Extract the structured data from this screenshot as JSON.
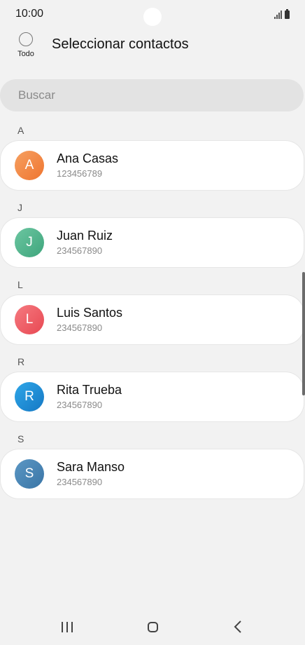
{
  "status_bar": {
    "time": "10:00"
  },
  "header": {
    "select_all_label": "Todo",
    "title": "Seleccionar contactos"
  },
  "search": {
    "placeholder": "Buscar"
  },
  "sections": [
    {
      "letter": "A",
      "contact": {
        "initial": "A",
        "name": "Ana Casas",
        "number": "123456789",
        "color": "#f0803c"
      }
    },
    {
      "letter": "J",
      "contact": {
        "initial": "J",
        "name": "Juan Ruiz",
        "number": "234567890",
        "color": "#4fb58c"
      }
    },
    {
      "letter": "L",
      "contact": {
        "initial": "L",
        "name": "Luis Santos",
        "number": "234567890",
        "color": "#ef5b63"
      }
    },
    {
      "letter": "R",
      "contact": {
        "initial": "R",
        "name": "Rita Trueba",
        "number": "234567890",
        "color": "#1f8fd6"
      }
    },
    {
      "letter": "S",
      "contact": {
        "initial": "S",
        "name": "Sara Manso",
        "number": "234567890",
        "color": "#4a86b5"
      }
    }
  ],
  "nav": {
    "recent_icon": "recent-apps-icon",
    "home_icon": "home-icon",
    "back_icon": "back-icon"
  }
}
